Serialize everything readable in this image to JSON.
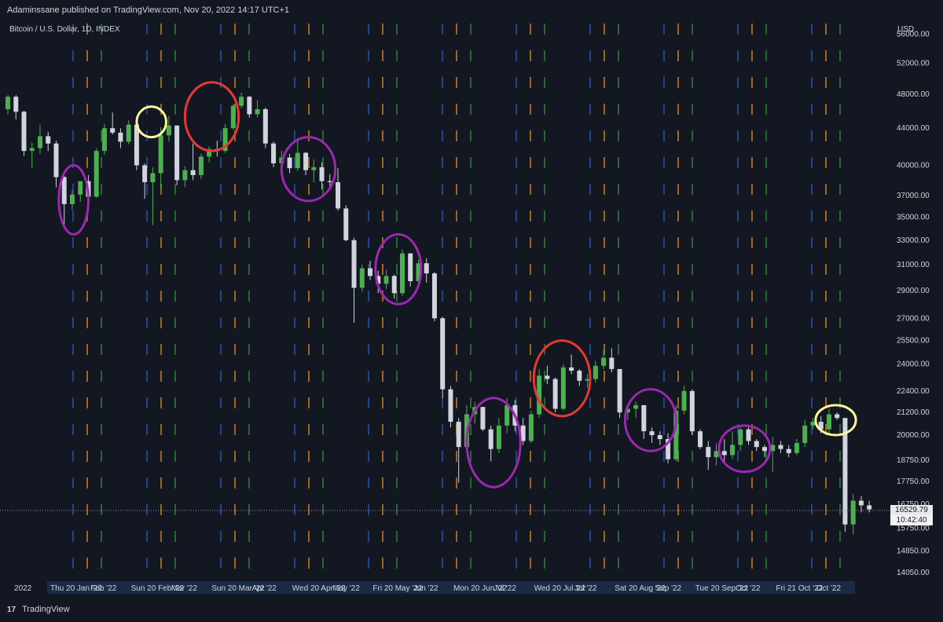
{
  "header": {
    "published_by": "Adaminssane published on TradingView.com, Nov 20, 2022 14:17 UTC+1"
  },
  "symbol": {
    "label": "Bitcoin / U.S. Dollar, 1D, INDEX"
  },
  "axis": {
    "currency": "USD",
    "year_label": "2022",
    "price_ticks": [
      "56000.00",
      "52000.00",
      "48000.00",
      "44000.00",
      "40000.00",
      "37000.00",
      "35000.00",
      "33000.00",
      "31000.00",
      "29000.00",
      "27000.00",
      "25500.00",
      "24000.00",
      "22400.00",
      "21200.00",
      "20000.00",
      "18750.00",
      "17750.00",
      "16750.00",
      "15750.00",
      "14850.00",
      "14050.00"
    ],
    "date_labels": [
      "Thu 20 Jan '22",
      "Feb '22",
      "Sun 20 Feb '22",
      "Mar '22",
      "Sun 20 Mar '22",
      "Apr '22",
      "Wed 20 Apr '22",
      "May '22",
      "Fri 20 May '22",
      "Jun '22",
      "Mon 20 Jun '22",
      "Jul '22",
      "Wed 20 Jul '22",
      "Jul '22",
      "Sat 20 Aug '22",
      "Sep '22",
      "Tue 20 Sep '22",
      "Oct '22",
      "Fri 21 Oct '22",
      "Oct '22"
    ]
  },
  "last_price": {
    "value": "16529.79",
    "countdown": "10:42:40"
  },
  "footer": {
    "logo_glyph": "17",
    "brand": "TradingView"
  },
  "colors": {
    "background": "#131722",
    "up": "#4caf50",
    "down": "#d1d4dc",
    "blue_marker": "#2a4fa8",
    "orange_marker": "#c47a1e",
    "green_marker": "#2e7d32",
    "circle_purple": "#9c27b0",
    "circle_red": "#e53935",
    "circle_yellow": "#fff59d"
  },
  "chart_data": {
    "type": "candlestick",
    "title": "Bitcoin / U.S. Dollar, 1D, INDEX",
    "ylabel": "USD",
    "ylim": [
      13800,
      58500
    ],
    "y_scale": "log",
    "x_range": [
      "2022-01-01",
      "2022-11-20"
    ],
    "last_price": 16529.79,
    "series": [
      {
        "name": "Bitcoin / U.S. Dollar",
        "values": [
          [
            "2022-01-01",
            46200,
            47900,
            45600,
            47700
          ],
          [
            "2022-01-04",
            47700,
            47900,
            45000,
            45900
          ],
          [
            "2022-01-07",
            45900,
            46000,
            41000,
            41500
          ],
          [
            "2022-01-10",
            41500,
            42400,
            39700,
            41800
          ],
          [
            "2022-01-13",
            41800,
            44400,
            41200,
            43100
          ],
          [
            "2022-01-16",
            43100,
            43600,
            41500,
            42300
          ],
          [
            "2022-01-19",
            42300,
            42600,
            37800,
            38800
          ],
          [
            "2022-01-22",
            38800,
            38900,
            34300,
            36200
          ],
          [
            "2022-01-25",
            36200,
            37500,
            35700,
            37100
          ],
          [
            "2022-01-28",
            37100,
            38400,
            36400,
            38400
          ],
          [
            "2022-01-31",
            38400,
            39000,
            36400,
            36900
          ],
          [
            "2022-02-03",
            36900,
            41800,
            36800,
            41500
          ],
          [
            "2022-02-06",
            41500,
            44500,
            41100,
            44000
          ],
          [
            "2022-02-09",
            44000,
            45800,
            43300,
            43500
          ],
          [
            "2022-02-12",
            43500,
            44000,
            41800,
            42500
          ],
          [
            "2022-02-15",
            42500,
            44900,
            42200,
            44400
          ],
          [
            "2022-02-18",
            44400,
            44400,
            39500,
            40000
          ],
          [
            "2022-02-21",
            40000,
            40200,
            36700,
            38300
          ],
          [
            "2022-02-24",
            38300,
            39800,
            34300,
            39200
          ],
          [
            "2022-02-27",
            39200,
            44100,
            37700,
            43200
          ],
          [
            "2022-03-02",
            43200,
            45400,
            42500,
            44300
          ],
          [
            "2022-03-05",
            44300,
            44300,
            38000,
            38500
          ],
          [
            "2022-03-08",
            38500,
            39900,
            37800,
            39500
          ],
          [
            "2022-03-11",
            39500,
            42300,
            38500,
            39000
          ],
          [
            "2022-03-14",
            39000,
            41200,
            38600,
            40900
          ],
          [
            "2022-03-17",
            40900,
            42000,
            40300,
            41700
          ],
          [
            "2022-03-20",
            41700,
            42600,
            40900,
            41500
          ],
          [
            "2022-03-23",
            41500,
            44500,
            41300,
            44000
          ],
          [
            "2022-03-26",
            44000,
            46800,
            43800,
            46600
          ],
          [
            "2022-03-29",
            46600,
            48200,
            46300,
            47700
          ],
          [
            "2022-04-01",
            47700,
            47800,
            45200,
            45600
          ],
          [
            "2022-04-04",
            45600,
            47300,
            45200,
            46200
          ],
          [
            "2022-04-07",
            46200,
            46400,
            41800,
            42300
          ],
          [
            "2022-04-10",
            42300,
            42500,
            39800,
            40200
          ],
          [
            "2022-04-13",
            40200,
            41500,
            39600,
            40800
          ],
          [
            "2022-04-16",
            40800,
            41200,
            39200,
            39700
          ],
          [
            "2022-04-19",
            39700,
            42900,
            39400,
            41300
          ],
          [
            "2022-04-22",
            41300,
            41400,
            39000,
            39500
          ],
          [
            "2022-04-25",
            39500,
            40600,
            38300,
            39800
          ],
          [
            "2022-04-28",
            39800,
            40300,
            37600,
            38400
          ],
          [
            "2022-05-01",
            38400,
            39100,
            37600,
            38300
          ],
          [
            "2022-05-04",
            38300,
            39700,
            35600,
            35800
          ],
          [
            "2022-05-07",
            35800,
            36100,
            32900,
            33000
          ],
          [
            "2022-05-10",
            33000,
            33200,
            26700,
            29200
          ],
          [
            "2022-05-13",
            29200,
            31000,
            28900,
            30700
          ],
          [
            "2022-05-16",
            30700,
            31300,
            29800,
            30100
          ],
          [
            "2022-05-19",
            30100,
            30500,
            28800,
            29500
          ],
          [
            "2022-05-22",
            29500,
            30600,
            29100,
            30100
          ],
          [
            "2022-05-25",
            30100,
            30200,
            28400,
            28800
          ],
          [
            "2022-05-28",
            28800,
            32200,
            28600,
            31900
          ],
          [
            "2022-05-31",
            31900,
            31900,
            29300,
            29700
          ],
          [
            "2022-06-03",
            29700,
            31400,
            29300,
            31100
          ],
          [
            "2022-06-06",
            31100,
            31500,
            29600,
            30300
          ],
          [
            "2022-06-09",
            30300,
            30400,
            26800,
            27000
          ],
          [
            "2022-06-12",
            27000,
            27100,
            22000,
            22500
          ],
          [
            "2022-06-15",
            22500,
            22700,
            20400,
            20700
          ],
          [
            "2022-06-18",
            20700,
            20900,
            17700,
            19400
          ],
          [
            "2022-06-21",
            19400,
            21600,
            19200,
            21100
          ],
          [
            "2022-06-24",
            21100,
            21800,
            20600,
            21500
          ],
          [
            "2022-06-27",
            21500,
            21500,
            20200,
            20300
          ],
          [
            "2022-06-30",
            20300,
            20500,
            18700,
            19300
          ],
          [
            "2022-07-03",
            19300,
            20900,
            19100,
            20500
          ],
          [
            "2022-07-06",
            20500,
            22000,
            20100,
            21600
          ],
          [
            "2022-07-09",
            21600,
            21900,
            20200,
            20500
          ],
          [
            "2022-07-12",
            20500,
            20900,
            19500,
            19700
          ],
          [
            "2022-07-15",
            19700,
            21300,
            19600,
            21100
          ],
          [
            "2022-07-18",
            21100,
            23700,
            20900,
            23300
          ],
          [
            "2022-07-21",
            23300,
            23900,
            22800,
            23100
          ],
          [
            "2022-07-24",
            23100,
            23200,
            21200,
            21400
          ],
          [
            "2022-07-27",
            21400,
            24000,
            21300,
            23800
          ],
          [
            "2022-07-30",
            23800,
            24600,
            23400,
            23600
          ],
          [
            "2022-08-02",
            23600,
            23700,
            22700,
            23000
          ],
          [
            "2022-08-05",
            23000,
            23400,
            22600,
            23100
          ],
          [
            "2022-08-08",
            23100,
            24200,
            22900,
            23900
          ],
          [
            "2022-08-11",
            23900,
            24900,
            23700,
            24400
          ],
          [
            "2022-08-14",
            24400,
            25000,
            23500,
            23700
          ],
          [
            "2022-08-17",
            23700,
            23700,
            20900,
            21200
          ],
          [
            "2022-08-20",
            21200,
            21500,
            20800,
            21400
          ],
          [
            "2022-08-23",
            21400,
            21800,
            20900,
            21600
          ],
          [
            "2022-08-26",
            21600,
            21600,
            19800,
            20200
          ],
          [
            "2022-08-29",
            20200,
            20400,
            19600,
            20000
          ],
          [
            "2022-09-01",
            20000,
            20200,
            19500,
            19800
          ],
          [
            "2022-09-04",
            19800,
            20100,
            18600,
            18800
          ],
          [
            "2022-09-07",
            18800,
            21600,
            18700,
            21300
          ],
          [
            "2022-09-10",
            21300,
            22700,
            21100,
            22400
          ],
          [
            "2022-09-13",
            22400,
            22500,
            20000,
            20200
          ],
          [
            "2022-09-16",
            20200,
            20300,
            19300,
            19400
          ],
          [
            "2022-09-19",
            19400,
            19700,
            18300,
            18900
          ],
          [
            "2022-09-22",
            18900,
            19600,
            18500,
            19200
          ],
          [
            "2022-09-25",
            19200,
            19800,
            18700,
            19000
          ],
          [
            "2022-09-28",
            19000,
            20200,
            18800,
            19500
          ],
          [
            "2022-10-01",
            19500,
            20400,
            19200,
            20300
          ],
          [
            "2022-10-04",
            20300,
            20500,
            19500,
            19700
          ],
          [
            "2022-10-07",
            19700,
            19800,
            19200,
            19400
          ],
          [
            "2022-10-10",
            19400,
            19500,
            18900,
            19200
          ],
          [
            "2022-10-13",
            19200,
            19900,
            18200,
            19500
          ],
          [
            "2022-10-16",
            19500,
            19700,
            19100,
            19300
          ],
          [
            "2022-10-19",
            19300,
            19500,
            18900,
            19100
          ],
          [
            "2022-10-22",
            19100,
            19800,
            19000,
            19600
          ],
          [
            "2022-10-25",
            19600,
            20800,
            19400,
            20500
          ],
          [
            "2022-10-28",
            20500,
            20900,
            20300,
            20700
          ],
          [
            "2022-10-31",
            20700,
            21000,
            20100,
            20300
          ],
          [
            "2022-11-03",
            20300,
            21400,
            20100,
            21100
          ],
          [
            "2022-11-06",
            21100,
            21200,
            20800,
            20900
          ],
          [
            "2022-11-09",
            20900,
            20900,
            15600,
            15900
          ],
          [
            "2022-11-12",
            15900,
            17200,
            15500,
            16900
          ],
          [
            "2022-11-15",
            16900,
            17100,
            16400,
            16700
          ],
          [
            "2022-11-18",
            16700,
            16900,
            16400,
            16530
          ]
        ]
      }
    ],
    "annotations": [
      {
        "color": "purple",
        "start": "2022-01-20",
        "end": "2022-01-31",
        "low": 33500,
        "high": 40000
      },
      {
        "color": "yellow",
        "start": "2022-02-18",
        "end": "2022-03-01",
        "low": 43000,
        "high": 46500
      },
      {
        "color": "red",
        "start": "2022-03-08",
        "end": "2022-03-28",
        "low": 41500,
        "high": 49500
      },
      {
        "color": "purple",
        "start": "2022-04-13",
        "end": "2022-05-03",
        "low": 36500,
        "high": 43000
      },
      {
        "color": "purple",
        "start": "2022-05-18",
        "end": "2022-06-04",
        "low": 28000,
        "high": 33500
      },
      {
        "color": "purple",
        "start": "2022-06-21",
        "end": "2022-07-11",
        "low": 17500,
        "high": 22000
      },
      {
        "color": "red",
        "start": "2022-07-16",
        "end": "2022-08-06",
        "low": 21000,
        "high": 25500
      },
      {
        "color": "purple",
        "start": "2022-08-19",
        "end": "2022-09-07",
        "low": 19200,
        "high": 22500
      },
      {
        "color": "purple",
        "start": "2022-09-23",
        "end": "2022-10-12",
        "low": 18200,
        "high": 20500
      },
      {
        "color": "yellow",
        "start": "2022-10-29",
        "end": "2022-11-13",
        "low": 20000,
        "high": 21600
      }
    ]
  }
}
